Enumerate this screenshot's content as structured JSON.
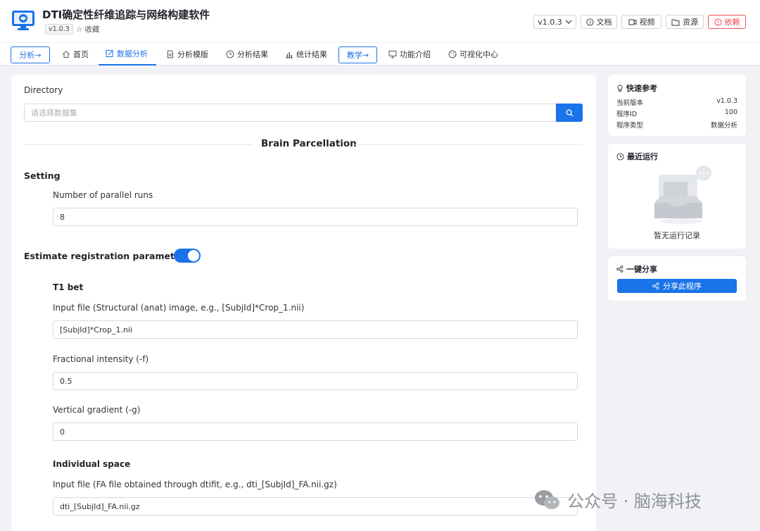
{
  "header": {
    "app_title": "DTI确定性纤维追踪与网络构建软件",
    "version_badge": "v1.0.3",
    "favorite_label": "收藏",
    "version_select": "v1.0.3",
    "docs_label": "文档",
    "video_label": "视频",
    "resources_label": "资源",
    "deps_label": "依赖"
  },
  "nav": {
    "analysis_btn": "分析→",
    "items": [
      {
        "label": "首页",
        "icon": "home-icon"
      },
      {
        "label": "数据分析",
        "icon": "edit-icon"
      },
      {
        "label": "分析模版",
        "icon": "file-icon"
      },
      {
        "label": "分析结果",
        "icon": "clock-icon"
      },
      {
        "label": "统计结果",
        "icon": "bar-chart-icon"
      }
    ],
    "teaching_btn": "教学→",
    "items2": [
      {
        "label": "功能介绍",
        "icon": "monitor-icon"
      },
      {
        "label": "可视化中心",
        "icon": "palette-icon"
      }
    ],
    "active": "数据分析"
  },
  "form": {
    "directory_label": "Directory",
    "directory_placeholder": "请选择数据集",
    "section_title": "Brain Parcellation",
    "setting_label": "Setting",
    "parallel_label": "Number of parallel runs",
    "parallel_value": "8",
    "estimate_label": "Estimate registration parameters",
    "estimate_enabled": true,
    "t1bet_label": "T1 bet",
    "input_label": "Input file (Structural (anat) image, e.g., [SubjId]*Crop_1.nii)",
    "input_value": "[SubjId]*Crop_1.nii",
    "frac_label": "Fractional intensity (-f)",
    "frac_value": "0.5",
    "grad_label": "Vertical gradient (-g)",
    "grad_value": "0",
    "indiv_label": "Individual space",
    "fa_label": "Input file (FA file obtained through dtifit, e.g., dti_[SubjId]_FA.nii.gz)",
    "fa_value": "dti_[SubjId]_FA.nii.gz"
  },
  "quick_ref": {
    "title": "快速参考",
    "rows": [
      {
        "key": "当前版本",
        "value": "v1.0.3"
      },
      {
        "key": "程序ID",
        "value": "100"
      },
      {
        "key": "程序类型",
        "value": "数据分析"
      }
    ]
  },
  "recent": {
    "title": "最近运行",
    "empty_text": "暂无运行记录"
  },
  "share": {
    "title": "一键分享",
    "button": "分享此程序"
  },
  "watermark": {
    "text": "公众号 · 脑海科技"
  },
  "colors": {
    "accent": "#1a73e8",
    "danger": "#f04040",
    "background": "#f0f2f5"
  }
}
